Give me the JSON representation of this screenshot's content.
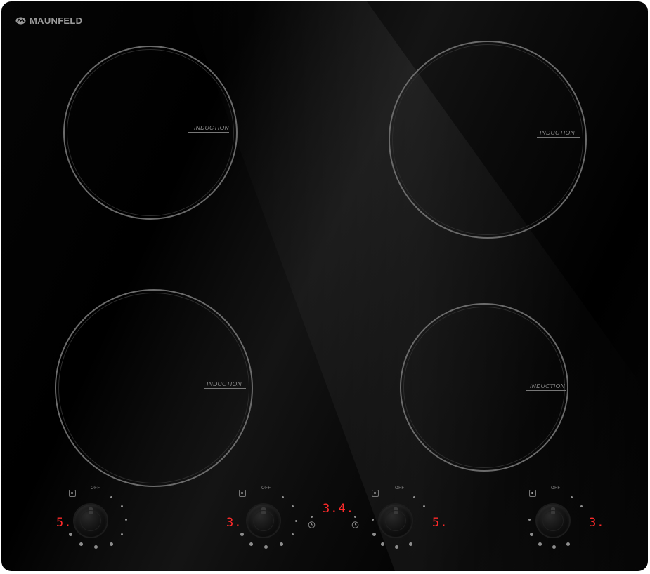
{
  "brand": {
    "name": "MAUNFELD"
  },
  "burners": {
    "top_left": {
      "label": "INDUCTION"
    },
    "top_right": {
      "label": "INDUCTION"
    },
    "bottom_left": {
      "label": "INDUCTION"
    },
    "bottom_right": {
      "label": "INDUCTION"
    }
  },
  "controls": {
    "off_label": "OFF",
    "zone1": {
      "display": "5."
    },
    "zone2": {
      "display": "3."
    },
    "zone3": {
      "display": "5."
    },
    "zone4": {
      "display": "3."
    },
    "timer": {
      "display": "3.4."
    }
  },
  "colors": {
    "glass": "#000000",
    "ring": "#6b6b6b",
    "led": "#ff2a2a",
    "text": "#9a9a9a"
  },
  "icons": [
    "maunfeld-logo-icon",
    "power-icon",
    "timer-icon",
    "knob-icon"
  ]
}
